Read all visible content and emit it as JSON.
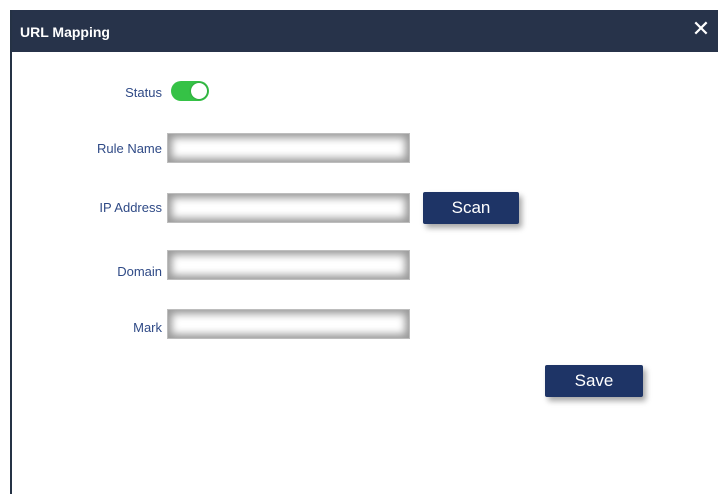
{
  "dialog": {
    "title": "URL Mapping",
    "close_glyph": "✕"
  },
  "form": {
    "status_label": "Status",
    "status_on": true,
    "rule_name_label": "Rule Name",
    "rule_name_value": "",
    "ip_address_label": "IP Address",
    "ip_address_value": "",
    "domain_label": "Domain",
    "domain_value": "",
    "mark_label": "Mark",
    "mark_value": ""
  },
  "buttons": {
    "scan_label": "Scan",
    "save_label": "Save"
  },
  "colors": {
    "titlebar": "#27334a",
    "label": "#2f4a86",
    "button": "#1e3466",
    "toggle_on": "#35c246"
  }
}
